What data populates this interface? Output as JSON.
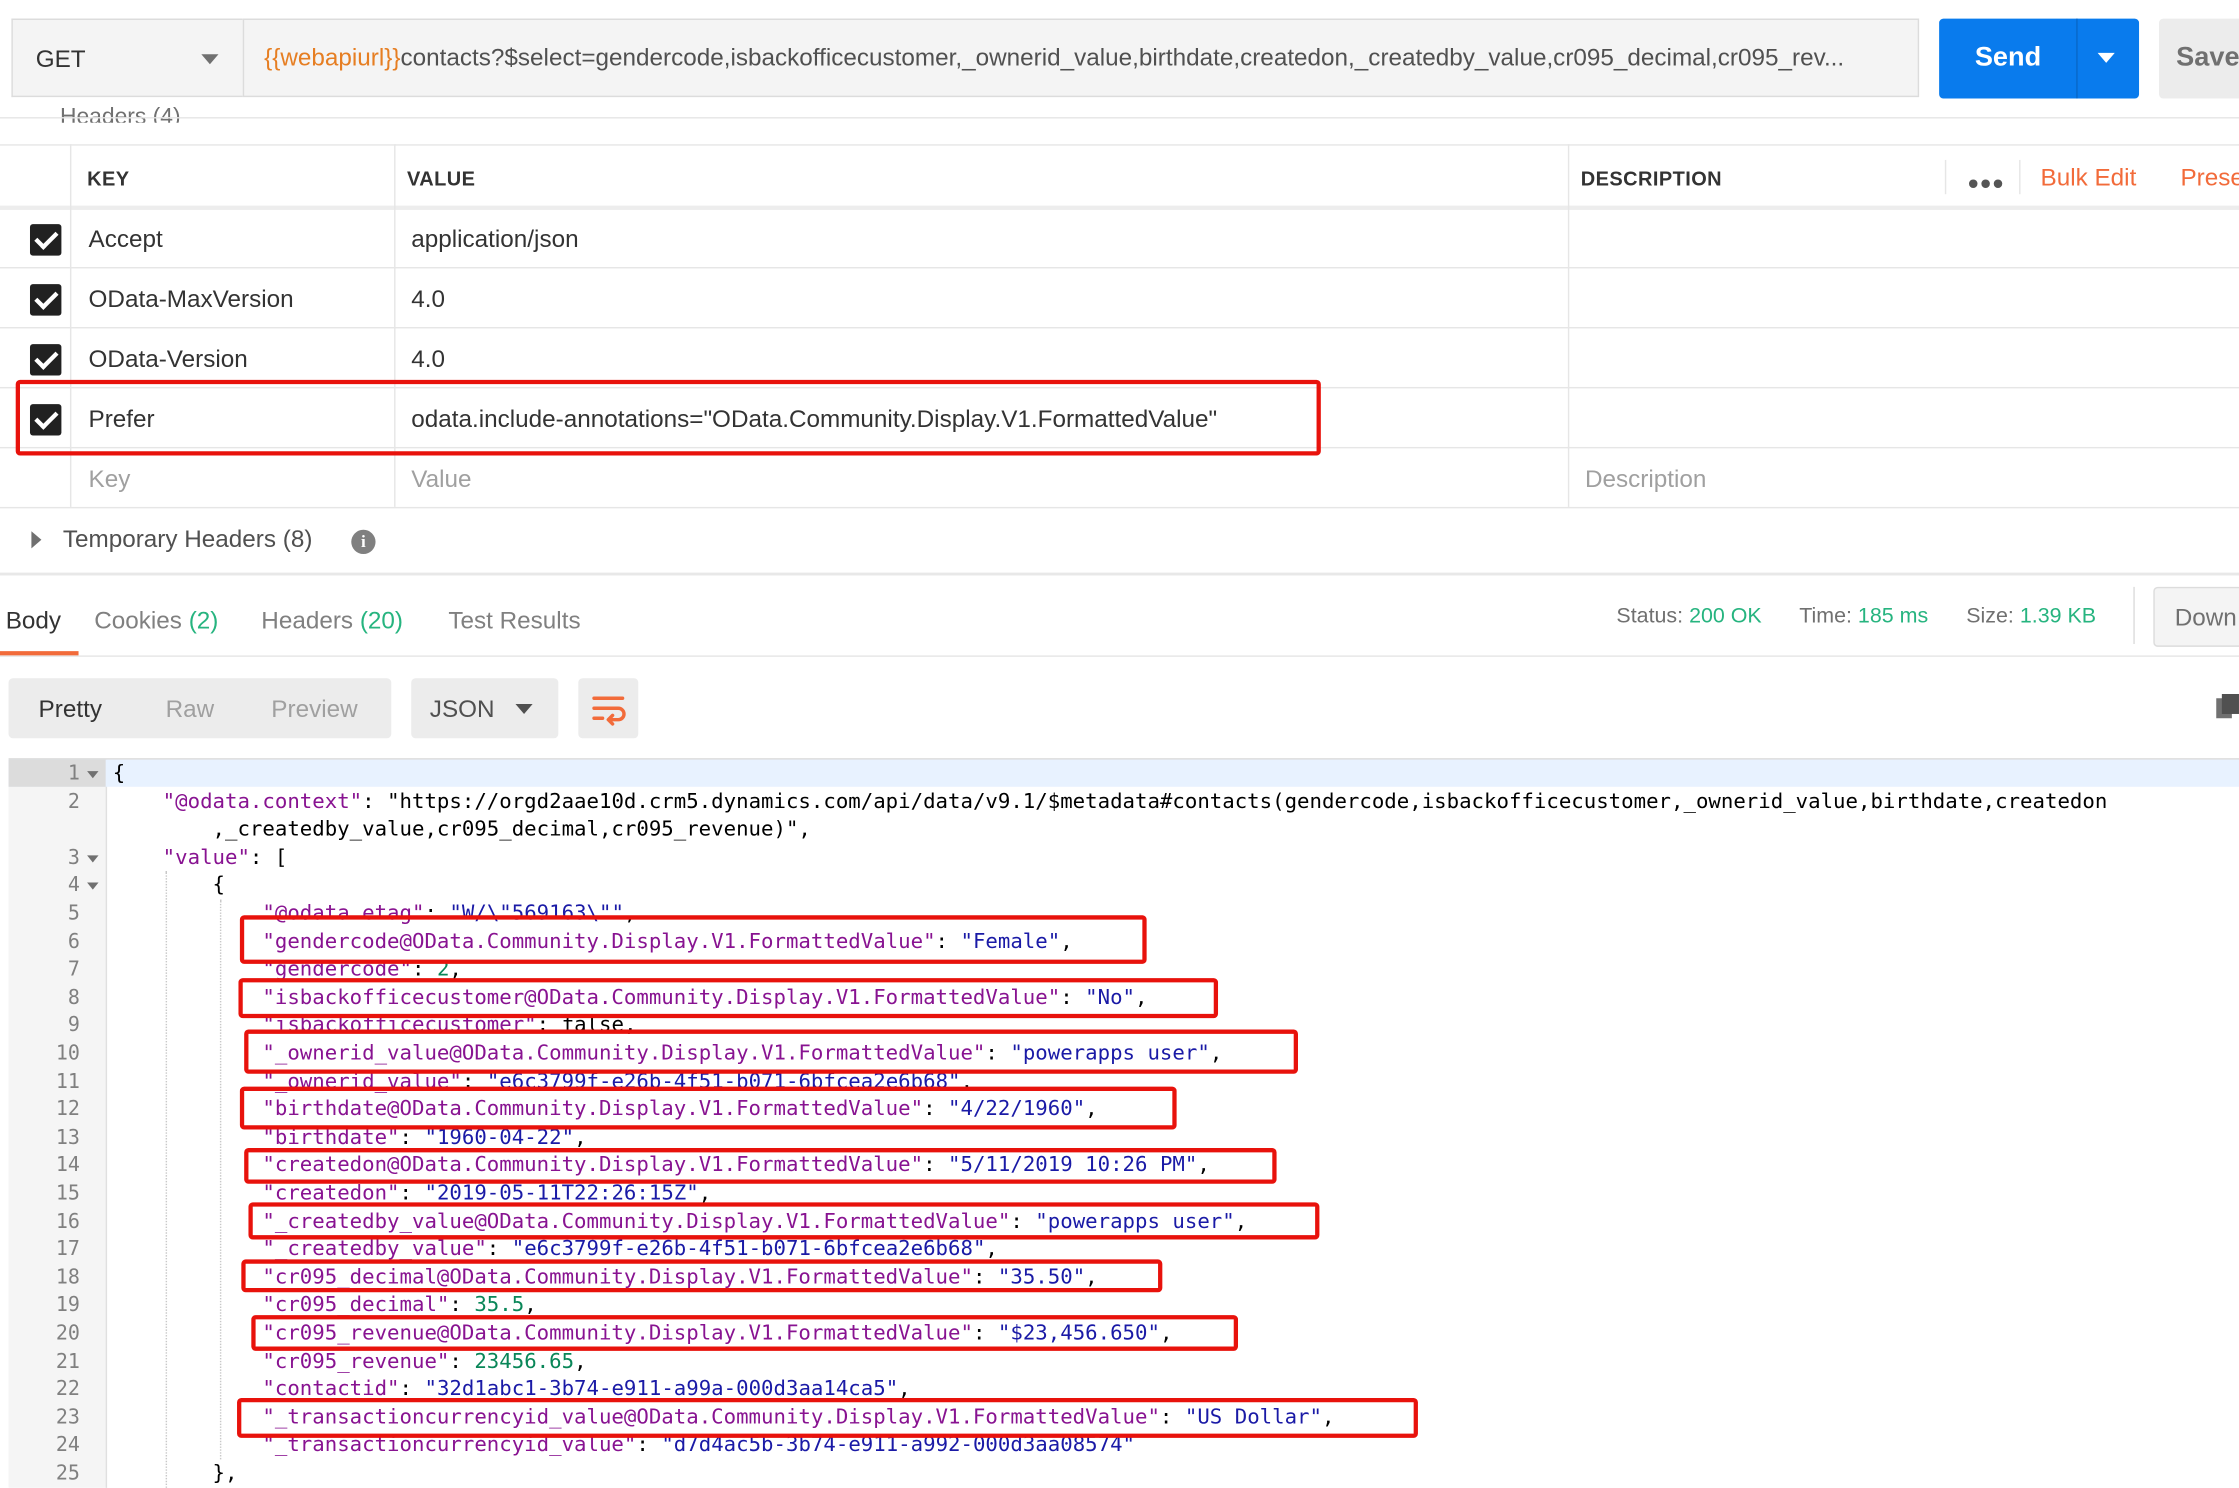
{
  "request": {
    "method": "GET",
    "url_var": "{{webapiurl}}",
    "url_rest": "contacts?$select=gendercode,isbackofficecustomer,_ownerid_value,birthdate,createdon,_createdby_value,cr095_decimal,cr095_rev...",
    "send_label": "Send",
    "save_label": "Save"
  },
  "headers_section": {
    "title_cut": "Headers (4)",
    "columns": {
      "key": "KEY",
      "value": "VALUE",
      "description": "DESCRIPTION"
    },
    "more_label": "•••",
    "bulk_edit": "Bulk Edit",
    "presets": "Prese",
    "rows": [
      {
        "checked": true,
        "key": "Accept",
        "value": "application/json"
      },
      {
        "checked": true,
        "key": "OData-MaxVersion",
        "value": "4.0"
      },
      {
        "checked": true,
        "key": "OData-Version",
        "value": "4.0"
      },
      {
        "checked": true,
        "key": "Prefer",
        "value": "odata.include-annotations=\"OData.Community.Display.V1.FormattedValue\""
      }
    ],
    "placeholder": {
      "key": "Key",
      "value": "Value",
      "description": "Description"
    },
    "temporary": {
      "label": "Temporary Headers",
      "count": "(8)"
    }
  },
  "response": {
    "tabs": [
      {
        "label": "Body",
        "count": ""
      },
      {
        "label": "Cookies",
        "count": "(2)"
      },
      {
        "label": "Headers",
        "count": "(20)"
      },
      {
        "label": "Test Results",
        "count": ""
      }
    ],
    "status": {
      "label": "Status:",
      "value": "200 OK"
    },
    "time": {
      "label": "Time:",
      "value": "185 ms"
    },
    "size": {
      "label": "Size:",
      "value": "1.39 KB"
    },
    "download_label": "Down",
    "views": [
      "Pretty",
      "Raw",
      "Preview"
    ],
    "format": "JSON"
  },
  "colors": {
    "accent": "#f26b3a",
    "send": "#097bed",
    "status_ok": "#26b47f",
    "highlight": "#e8120c"
  },
  "icons": [
    "chevron-down-icon",
    "checkbox-checked-icon",
    "info-icon",
    "wrap-lines-icon",
    "copy-icon",
    "fold-arrow-icon"
  ],
  "code_lines": [
    {
      "n": "1",
      "fold": true,
      "t": "{"
    },
    {
      "n": "2",
      "fold": false,
      "t": "    \"@odata.context\": \"https://orgd2aae10d.crm5.dynamics.com/api/data/v9.1/$metadata#contacts(gendercode,isbackofficecustomer,_ownerid_value,birthdate,createdon"
    },
    {
      "n": "",
      "fold": false,
      "t": "        ,_createdby_value,cr095_decimal,cr095_revenue)\","
    },
    {
      "n": "3",
      "fold": true,
      "t": "    \"value\": ["
    },
    {
      "n": "4",
      "fold": true,
      "t": "        {"
    },
    {
      "n": "5",
      "fold": false,
      "t": "            \"@odata.etag\": \"W/\\\"569163\\\"\","
    },
    {
      "n": "6",
      "fold": false,
      "t": "            \"gendercode@OData.Community.Display.V1.FormattedValue\": \"Female\","
    },
    {
      "n": "7",
      "fold": false,
      "t": "            \"gendercode\": 2,"
    },
    {
      "n": "8",
      "fold": false,
      "t": "            \"isbackofficecustomer@OData.Community.Display.V1.FormattedValue\": \"No\","
    },
    {
      "n": "9",
      "fold": false,
      "t": "            \"isbackofficecustomer\": false,"
    },
    {
      "n": "10",
      "fold": false,
      "t": "            \"_ownerid_value@OData.Community.Display.V1.FormattedValue\": \"powerapps user\","
    },
    {
      "n": "11",
      "fold": false,
      "t": "            \"_ownerid_value\": \"e6c3799f-e26b-4f51-b071-6bfcea2e6b68\","
    },
    {
      "n": "12",
      "fold": false,
      "t": "            \"birthdate@OData.Community.Display.V1.FormattedValue\": \"4/22/1960\","
    },
    {
      "n": "13",
      "fold": false,
      "t": "            \"birthdate\": \"1960-04-22\","
    },
    {
      "n": "14",
      "fold": false,
      "t": "            \"createdon@OData.Community.Display.V1.FormattedValue\": \"5/11/2019 10:26 PM\","
    },
    {
      "n": "15",
      "fold": false,
      "t": "            \"createdon\": \"2019-05-11T22:26:15Z\","
    },
    {
      "n": "16",
      "fold": false,
      "t": "            \"_createdby_value@OData.Community.Display.V1.FormattedValue\": \"powerapps user\","
    },
    {
      "n": "17",
      "fold": false,
      "t": "            \"_createdby_value\": \"e6c3799f-e26b-4f51-b071-6bfcea2e6b68\","
    },
    {
      "n": "18",
      "fold": false,
      "t": "            \"cr095_decimal@OData.Community.Display.V1.FormattedValue\": \"35.50\","
    },
    {
      "n": "19",
      "fold": false,
      "t": "            \"cr095_decimal\": 35.5,"
    },
    {
      "n": "20",
      "fold": false,
      "t": "            \"cr095_revenue@OData.Community.Display.V1.FormattedValue\": \"$23,456.650\","
    },
    {
      "n": "21",
      "fold": false,
      "t": "            \"cr095_revenue\": 23456.65,"
    },
    {
      "n": "22",
      "fold": false,
      "t": "            \"contactid\": \"32d1abc1-3b74-e911-a99a-000d3aa14ca5\","
    },
    {
      "n": "23",
      "fold": false,
      "t": "            \"_transactioncurrencyid_value@OData.Community.Display.V1.FormattedValue\": \"US Dollar\","
    },
    {
      "n": "24",
      "fold": false,
      "t": "            \"_transactioncurrencyid_value\": \"d7d4ac5b-3b74-e911-a992-000d3aa08574\""
    },
    {
      "n": "25",
      "fold": false,
      "t": "        },"
    }
  ]
}
